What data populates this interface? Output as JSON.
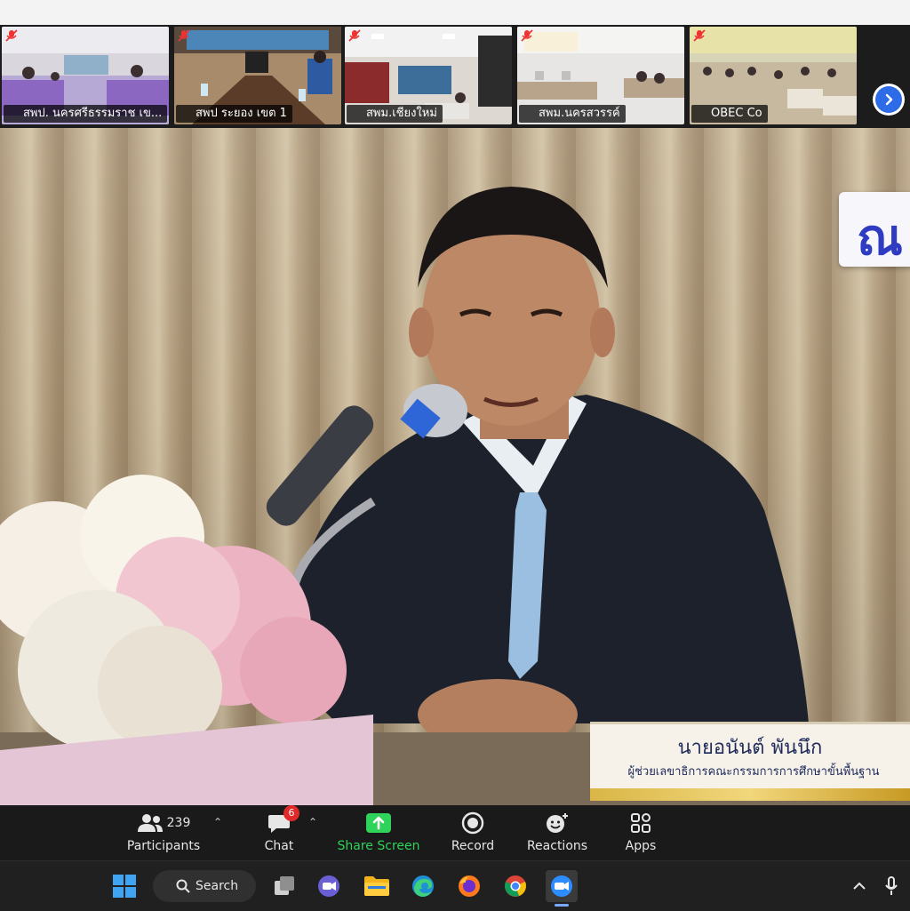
{
  "thumbnails": [
    {
      "name": "สพป. นครศรีธรรมราช เข...",
      "scene": "meeting-room-purple"
    },
    {
      "name": "สพป ระยอง เขต 1",
      "scene": "office-table"
    },
    {
      "name": "สพม.เชียงใหม่",
      "scene": "hall-screen"
    },
    {
      "name": "สพม.นครสวรรค์",
      "scene": "classroom-desks"
    },
    {
      "name": "OBEC Co",
      "scene": "large-hall"
    }
  ],
  "nameplate": {
    "name": "นายอนันต์ พันนึก",
    "title": "ผู้ช่วยเลขาธิการคณะกรรมการการศึกษาขั้นพื้นฐาน"
  },
  "sign_text": "ณ",
  "toolbar": {
    "participants_label": "Participants",
    "participants_count": "239",
    "chat_label": "Chat",
    "chat_badge": "6",
    "share_label": "Share Screen",
    "record_label": "Record",
    "reactions_label": "Reactions",
    "apps_label": "Apps"
  },
  "taskbar": {
    "search_label": "Search"
  },
  "colors": {
    "share_green": "#2fd35a",
    "badge_red": "#e02a2a",
    "next_blue": "#2e6be6"
  }
}
